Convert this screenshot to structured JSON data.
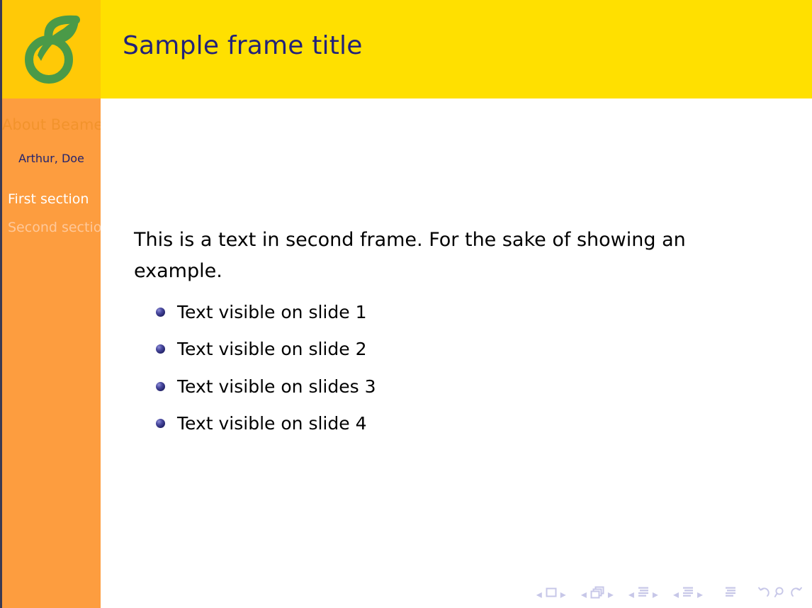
{
  "slide": {
    "frame_title": "Sample frame title",
    "colors": {
      "logo_background": "#ffc907",
      "title_bar": "#ffe000",
      "sidebar": "#fd9d3f",
      "title_text": "#22227a",
      "body_text": "#000000",
      "bullet": "#2a2a72",
      "logo_green": "#4a9a48",
      "active_section": "#ffffff",
      "inactive_section": "#fec89a",
      "dimmed_title": "#f2932c",
      "nav_symbols": "#c7c7e8"
    }
  },
  "logo": {
    "name": "beamer-sprout-logo",
    "description": "green sprout six with leaf"
  },
  "sidebar": {
    "presentation_title": "About Beamer",
    "author": "Arthur, Doe",
    "sections": [
      {
        "label": "First section",
        "active": true
      },
      {
        "label": "Second section",
        "active": false
      }
    ]
  },
  "content": {
    "paragraph": "This is a text in second frame. For the sake of showing an example.",
    "bullets": [
      "Text visible on slide 1",
      "Text visible on slide 2",
      "Text visible on slides 3",
      "Text visible on slide 4"
    ]
  },
  "navigation": {
    "groups": [
      {
        "name": "slide",
        "icon": "square-icon",
        "prev": "◂",
        "next": "▸"
      },
      {
        "name": "frame",
        "icon": "stacked-frames-icon",
        "prev": "◂",
        "next": "▸"
      },
      {
        "name": "subsection",
        "icon": "lines-icon",
        "prev": "◂",
        "next": "▸"
      },
      {
        "name": "section",
        "icon": "lines-icon",
        "prev": "◂",
        "next": "▸"
      }
    ],
    "presentation_icon": "lines-icon",
    "back_icon": "back-arrow-icon",
    "search_icon": "magnifier-icon",
    "forward_icon": "forward-arrow-icon"
  }
}
